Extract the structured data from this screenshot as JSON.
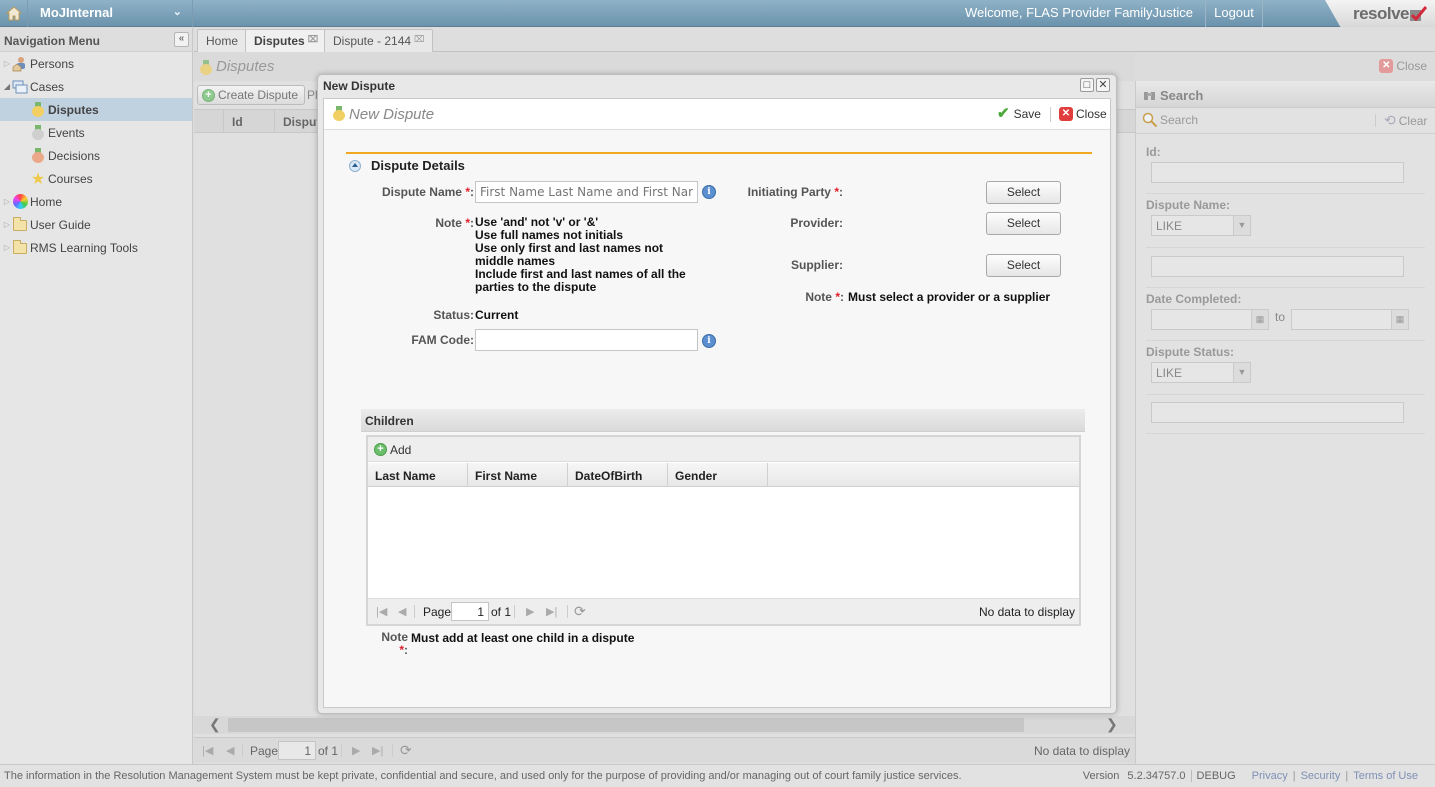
{
  "topbar": {
    "app_name": "MoJInternal",
    "welcome": "Welcome, FLAS Provider FamilyJustice",
    "logout": "Logout",
    "logo": "resolve"
  },
  "nav": {
    "title": "Navigation Menu",
    "collapse": "«",
    "items": [
      {
        "label": "Persons"
      },
      {
        "label": "Cases"
      },
      {
        "label": "Disputes",
        "selected": true
      },
      {
        "label": "Events"
      },
      {
        "label": "Decisions"
      },
      {
        "label": "Courses"
      },
      {
        "label": "Home"
      },
      {
        "label": "User Guide"
      },
      {
        "label": "RMS Learning Tools"
      }
    ]
  },
  "tabs": [
    {
      "label": "Home"
    },
    {
      "label": "Disputes",
      "active": true
    },
    {
      "label": "Dispute - 2144"
    }
  ],
  "disputes_panel": {
    "title": "Disputes",
    "close": "Close",
    "create_button": "Create Dispute",
    "truncated_toolbar_text": "Pl",
    "columns": [
      "Id",
      "Dispute"
    ],
    "pager": {
      "page_label": "Page",
      "page": "1",
      "of": "of 1",
      "status": "No data to display"
    }
  },
  "search_panel": {
    "title": "Search",
    "search_button": "Search",
    "clear_button": "Clear",
    "fields": {
      "id_label": "Id:",
      "dispute_name_label": "Dispute Name:",
      "dispute_name_operator": "LIKE",
      "date_completed_label": "Date Completed:",
      "date_to": "to",
      "dispute_status_label": "Dispute Status:",
      "dispute_status_operator": "LIKE"
    }
  },
  "modal": {
    "window_title": "New Dispute",
    "header_title": "New Dispute",
    "save": "Save",
    "close": "Close",
    "section_title": "Dispute Details",
    "dispute_name_label": "Dispute Name",
    "dispute_name_placeholder": "First Name Last Name and First Name Last Name",
    "note_label": "Note",
    "note_lines": [
      "Use 'and' not 'v' or '&'",
      "Use full names not initials",
      "Use only first and last names not middle names",
      "Include first and last names of all the parties to the dispute"
    ],
    "status_label": "Status:",
    "status_value": "Current",
    "fam_code_label": "FAM Code:",
    "fam_code_value": "",
    "initiating_party_label": "Initiating Party",
    "provider_label": "Provider:",
    "supplier_label": "Supplier:",
    "select_label": "Select",
    "party_note": "Must select a provider or a supplier",
    "required_mark": "*",
    "colon": ":",
    "children": {
      "title": "Children",
      "add": "Add",
      "columns": [
        "Last Name",
        "First Name",
        "DateOfBirth",
        "Gender"
      ],
      "pager": {
        "page_label": "Page",
        "page": "1",
        "of": "of 1",
        "status": "No data to display"
      },
      "note": "Must add at least one child in a dispute"
    }
  },
  "footer": {
    "notice": "The information in the Resolution Management System must be kept private, confidential and secure, and used only for the purpose of providing and/or managing out of court family justice services.",
    "version_label": "Version",
    "version": "5.2.34757.0",
    "build": "DEBUG",
    "links": [
      "Privacy",
      "Security",
      "Terms of Use"
    ]
  }
}
